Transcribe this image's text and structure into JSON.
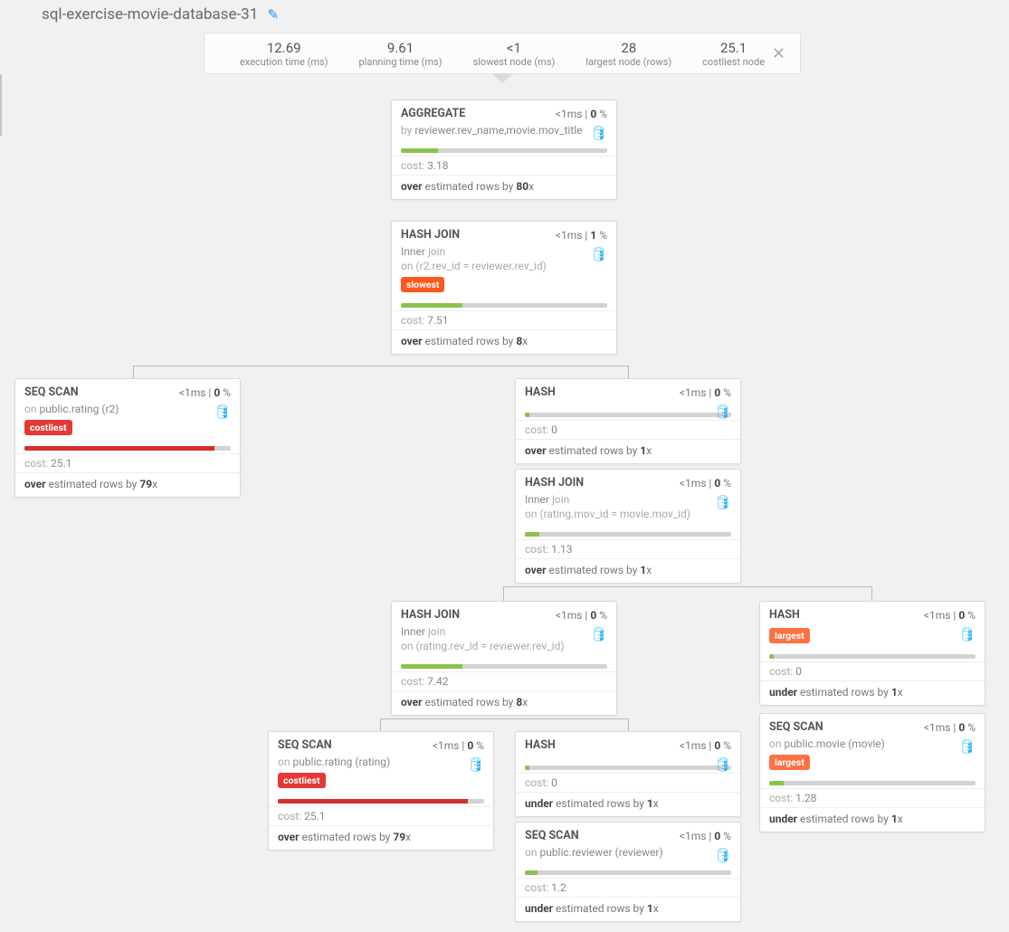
{
  "title": "sql-exercise-movie-database-31",
  "stats": [
    {
      "value": "12.69",
      "label": "execution time (ms)"
    },
    {
      "value": "9.61",
      "label": "planning time (ms)"
    },
    {
      "value": "<1",
      "label": "slowest node (ms)"
    },
    {
      "value": "28",
      "label": "largest node (rows)"
    },
    {
      "value": "25.1",
      "label": "costliest node"
    }
  ],
  "close_glyph": "✕",
  "pencil_glyph": "✎",
  "db_glyph": "🛢",
  "nodes": {
    "aggregate": {
      "title": "AGGREGATE",
      "time": "<1",
      "pct": "0",
      "sub_pre": "by ",
      "sub_val": "reviewer.rev_name,movie.mov_title",
      "bar_pct": 18,
      "bar_class": "bar-green",
      "cost": "3.18",
      "est_pre": "over",
      "est_mid": " estimated rows by ",
      "est_x": "80"
    },
    "hashjoin1": {
      "title": "HASH JOIN",
      "time": "<1",
      "pct": "1",
      "sub_pre": "Inner ",
      "sub_muted": "join",
      "on": "on (r2.rev_id = reviewer.rev_id)",
      "badge": "slowest",
      "badge_class": "badge-slow",
      "bar_pct": 30,
      "bar_class": "bar-green",
      "cost": "7.51",
      "est_pre": "over",
      "est_mid": " estimated rows by ",
      "est_x": "8"
    },
    "seqscan_r2": {
      "title": "SEQ SCAN",
      "time": "<1",
      "pct": "0",
      "sub_pre": "on ",
      "sub_val": "public.rating (r2)",
      "badge": "costliest",
      "badge_class": "badge-cost",
      "bar_pct": 92,
      "bar_class": "bar-red",
      "cost": "25.1",
      "est_pre": "over",
      "est_mid": " estimated rows by ",
      "est_x": "79"
    },
    "hash1": {
      "title": "HASH",
      "time": "<1",
      "pct": "0",
      "bar_pct": 2,
      "bar_class": "bar-green",
      "cost": "0",
      "est_pre": "over",
      "est_mid": " estimated rows by ",
      "est_x": "1"
    },
    "hashjoin2": {
      "title": "HASH JOIN",
      "time": "<1",
      "pct": "0",
      "sub_pre": "Inner ",
      "sub_muted": "join",
      "on": "on (rating.mov_id = movie.mov_id)",
      "bar_pct": 7,
      "bar_class": "bar-green",
      "cost": "1.13",
      "est_pre": "over",
      "est_mid": " estimated rows by ",
      "est_x": "1"
    },
    "hashjoin3": {
      "title": "HASH JOIN",
      "time": "<1",
      "pct": "0",
      "sub_pre": "Inner ",
      "sub_muted": "join",
      "on": "on (rating.rev_id = reviewer.rev_id)",
      "bar_pct": 30,
      "bar_class": "bar-green",
      "cost": "7.42",
      "est_pre": "over",
      "est_mid": " estimated rows by ",
      "est_x": "8"
    },
    "seqscan_rating": {
      "title": "SEQ SCAN",
      "time": "<1",
      "pct": "0",
      "sub_pre": "on ",
      "sub_val": "public.rating (rating)",
      "badge": "costliest",
      "badge_class": "badge-cost",
      "bar_pct": 92,
      "bar_class": "bar-red",
      "cost": "25.1",
      "est_pre": "over",
      "est_mid": " estimated rows by ",
      "est_x": "79"
    },
    "hash2": {
      "title": "HASH",
      "time": "<1",
      "pct": "0",
      "bar_pct": 2,
      "bar_class": "bar-green",
      "cost": "0",
      "est_pre": "under",
      "est_mid": " estimated rows by ",
      "est_x": "1"
    },
    "seqscan_reviewer": {
      "title": "SEQ SCAN",
      "time": "<1",
      "pct": "0",
      "sub_pre": "on ",
      "sub_val": "public.reviewer (reviewer)",
      "bar_pct": 6,
      "bar_class": "bar-green",
      "cost": "1.2",
      "est_pre": "under",
      "est_mid": " estimated rows by ",
      "est_x": "1"
    },
    "hash3": {
      "title": "HASH",
      "time": "<1",
      "pct": "0",
      "badge": "largest",
      "badge_class": "badge-large",
      "bar_pct": 2,
      "bar_class": "bar-green",
      "cost": "0",
      "est_pre": "under",
      "est_mid": " estimated rows by ",
      "est_x": "1"
    },
    "seqscan_movie": {
      "title": "SEQ SCAN",
      "time": "<1",
      "pct": "0",
      "sub_pre": "on ",
      "sub_val": "public.movie (movie)",
      "badge": "largest",
      "badge_class": "badge-large",
      "bar_pct": 7,
      "bar_class": "bar-green",
      "cost": "1.28",
      "est_pre": "under",
      "est_mid": " estimated rows by ",
      "est_x": "1"
    }
  },
  "labels": {
    "cost": "cost: ",
    "ms": "ms",
    "sep": " | ",
    "pct": " %",
    "x": "x"
  }
}
